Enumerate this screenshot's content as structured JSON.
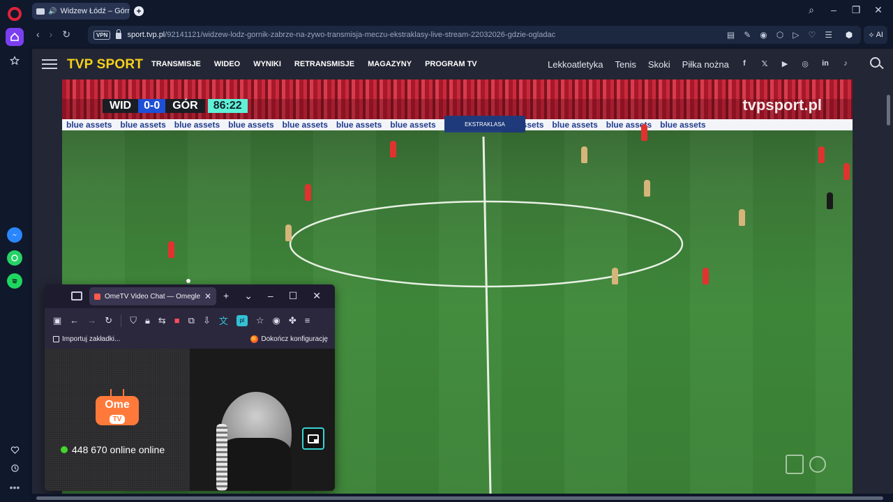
{
  "browser": {
    "tab_title": "Widzew Łódź – Górnik",
    "url_host": "sport.tvp.pl",
    "url_path": "/92141121/widzew-lodz-gornik-zabrze-na-zywo-transmisja-meczu-ekstraklasy-live-stream-22032026-gdzie-ogladac",
    "vpn_label": "VPN",
    "ai_label": "AI"
  },
  "site": {
    "logo": "TVP SPORT",
    "main_nav": [
      "TRANSMISJE",
      "WIDEO",
      "WYNIKI",
      "RETRANSMISJE",
      "MAGAZYNY",
      "PROGRAM TV"
    ],
    "sport_nav": [
      "Lekkoatletyka",
      "Tenis",
      "Skoki",
      "Piłka nożna"
    ],
    "social": [
      "f",
      "𝕏",
      "▶",
      "◎",
      "in",
      "♪"
    ]
  },
  "video": {
    "home_team": "WID",
    "score": "0-0",
    "away_team": "GÓR",
    "clock": "86:22",
    "watermark": "tvpsport.pl",
    "banner_text": "blue assets",
    "board_text": "EKSTRAKLASA"
  },
  "pip_window": {
    "tab_title": "OmeTV Video Chat — Omegle",
    "bookmark_import": "Importuj zakładki...",
    "bookmark_setup": "Dokończ konfigurację",
    "ome_logo_top": "Ome",
    "ome_logo_bottom": "TV",
    "online_text": "448 670 online online"
  },
  "colors": {
    "tvp_yellow": "#f7d21b",
    "score_blue": "#1e4fd6",
    "clock_cyan": "#5ff0d6",
    "ome_orange": "#ff7a3a",
    "online_green": "#44d62c"
  }
}
